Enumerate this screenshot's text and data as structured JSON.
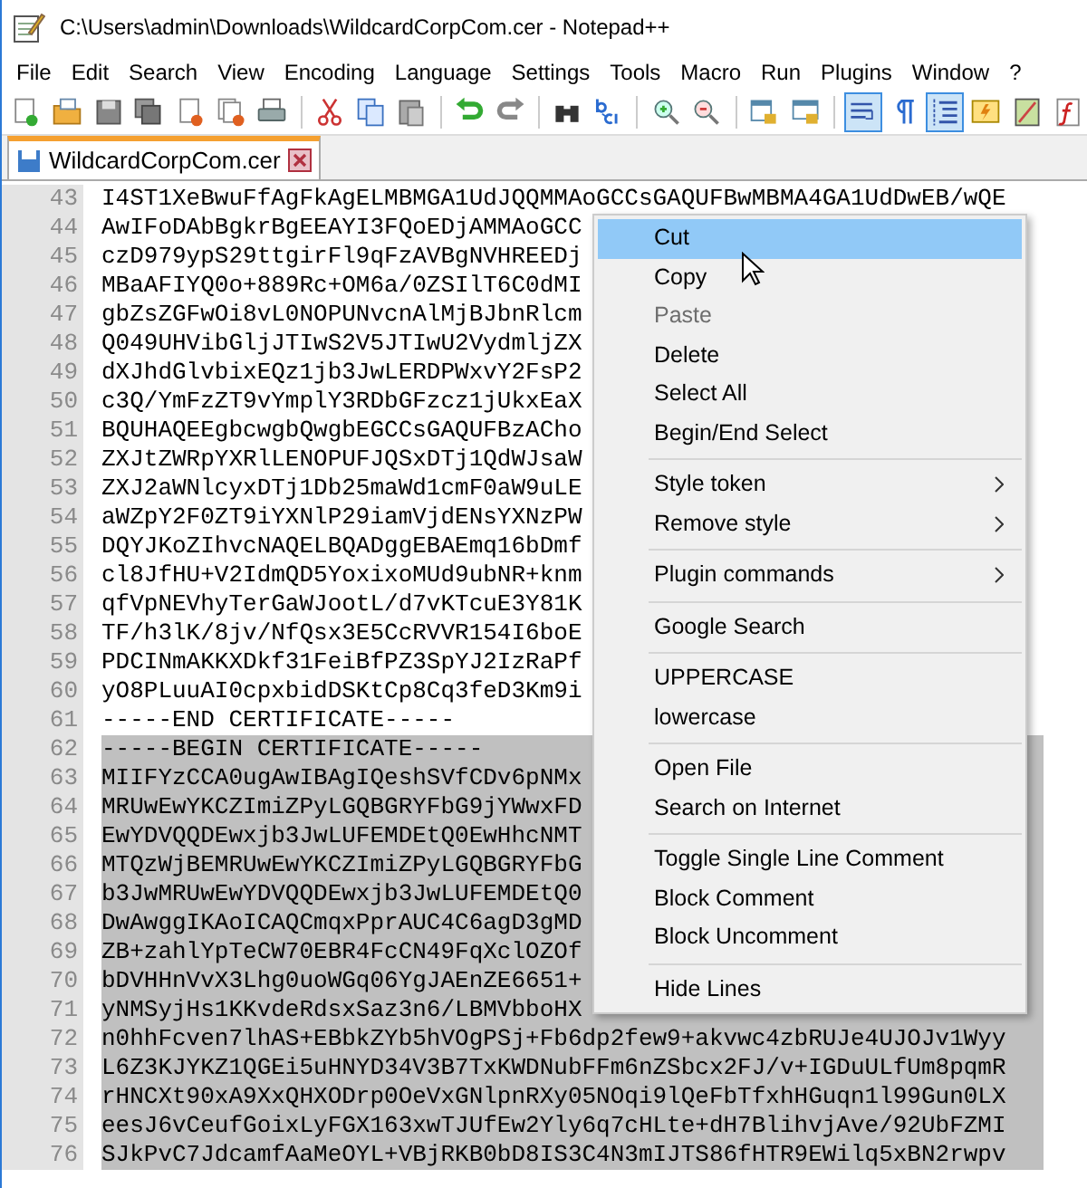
{
  "window": {
    "title": "C:\\Users\\admin\\Downloads\\WildcardCorpCom.cer - Notepad++"
  },
  "menu_bar": [
    "File",
    "Edit",
    "Search",
    "View",
    "Encoding",
    "Language",
    "Settings",
    "Tools",
    "Macro",
    "Run",
    "Plugins",
    "Window",
    "?"
  ],
  "toolbar": [
    {
      "kind": "new",
      "selected": false
    },
    {
      "kind": "open",
      "selected": false
    },
    {
      "kind": "save",
      "selected": false
    },
    {
      "kind": "save-all",
      "selected": false
    },
    {
      "kind": "close",
      "selected": false
    },
    {
      "kind": "close-all",
      "selected": false
    },
    {
      "kind": "print",
      "selected": false
    },
    {
      "kind": "separator"
    },
    {
      "kind": "cut",
      "selected": false
    },
    {
      "kind": "copy",
      "selected": false
    },
    {
      "kind": "paste",
      "selected": false
    },
    {
      "kind": "separator"
    },
    {
      "kind": "undo",
      "selected": false
    },
    {
      "kind": "redo",
      "selected": false
    },
    {
      "kind": "separator"
    },
    {
      "kind": "find",
      "selected": false
    },
    {
      "kind": "replace",
      "selected": false
    },
    {
      "kind": "separator"
    },
    {
      "kind": "zoom-in",
      "selected": false
    },
    {
      "kind": "zoom-out",
      "selected": false
    },
    {
      "kind": "separator"
    },
    {
      "kind": "sync-v",
      "selected": false
    },
    {
      "kind": "sync-h",
      "selected": false
    },
    {
      "kind": "separator"
    },
    {
      "kind": "wrap",
      "selected": true
    },
    {
      "kind": "all-chars",
      "selected": false
    },
    {
      "kind": "indent-guide",
      "selected": true
    },
    {
      "kind": "udl",
      "selected": false
    },
    {
      "kind": "doc-map",
      "selected": false
    },
    {
      "kind": "function-list",
      "selected": false
    }
  ],
  "tabs": [
    {
      "label": "WildcardCorpCom.cer",
      "selected": true
    }
  ],
  "editor": {
    "lines": [
      {
        "number": "43",
        "text": "I4ST1XeBwuFfAgFkAgELMBMGA1UdJQQMMAoGCCsGAQUFBwMBMA4GA1UdDwEB/wQE",
        "selected": false
      },
      {
        "number": "44",
        "text": "AwIFoDAbBgkrBgEEAYI3FQoEDjAMMAoGCC",
        "selected": false
      },
      {
        "number": "45",
        "text": "czD979ypS29ttgirFl9qFzAVBgNVHREEDj",
        "selected": false
      },
      {
        "number": "46",
        "text": "MBaAFIYQ0o+889Rc+OM6a/0ZSIlT6C0dMI",
        "selected": false
      },
      {
        "number": "47",
        "text": "gbZsZGFwOi8vL0NOPUNvcnAlMjBJbnRlcm",
        "selected": false
      },
      {
        "number": "48",
        "text": "Q049UHVibGljJTIwS2V5JTIwU2VydmljZX",
        "selected": false
      },
      {
        "number": "49",
        "text": "dXJhdGlvbixEQz1jb3JwLERDPWxvY2FsP2",
        "selected": false
      },
      {
        "number": "50",
        "text": "c3Q/YmFzZT9vYmplY3RDbGFzcz1jUkxEaX",
        "selected": false
      },
      {
        "number": "51",
        "text": "BQUHAQEEgbcwgbQwgbEGCCsGAQUFBzACho",
        "selected": false
      },
      {
        "number": "52",
        "text": "ZXJtZWRpYXRlLENOPUFJQSxDTj1QdWJsaW",
        "selected": false
      },
      {
        "number": "53",
        "text": "ZXJ2aWNlcyxDTj1Db25maWd1cmF0aW9uLE",
        "selected": false
      },
      {
        "number": "54",
        "text": "aWZpY2F0ZT9iYXNlP29iamVjdENsYXNzPW",
        "selected": false
      },
      {
        "number": "55",
        "text": "DQYJKoZIhvcNAQELBQADggEBAEmq16bDmf",
        "selected": false
      },
      {
        "number": "56",
        "text": "cl8JfHU+V2IdmQD5YoxixoMUd9ubNR+knm",
        "selected": false
      },
      {
        "number": "57",
        "text": "qfVpNEVhyTerGaWJootL/d7vKTcuE3Y81K",
        "selected": false
      },
      {
        "number": "58",
        "text": "TF/h3lK/8jv/NfQsx3E5CcRVVR154I6boE",
        "selected": false
      },
      {
        "number": "59",
        "text": "PDCINmAKKXDkf31FeiBfPZ3SpYJ2IzRaPf",
        "selected": false
      },
      {
        "number": "60",
        "text": "yO8PLuuAI0cpxbidDSKtCp8Cq3feD3Km9i",
        "selected": false
      },
      {
        "number": "61",
        "text": "-----END CERTIFICATE-----",
        "selected": false
      },
      {
        "number": "62",
        "text": "-----BEGIN CERTIFICATE-----",
        "selected": true
      },
      {
        "number": "63",
        "text": "MIIFYzCCA0ugAwIBAgIQeshSVfCDv6pNMx",
        "selected": true
      },
      {
        "number": "64",
        "text": "MRUwEwYKCZImiZPyLGQBGRYFbG9jYWwxFD",
        "selected": true
      },
      {
        "number": "65",
        "text": "EwYDVQQDEwxjb3JwLUFEMDEtQ0EwHhcNMT",
        "selected": true
      },
      {
        "number": "66",
        "text": "MTQzWjBEMRUwEwYKCZImiZPyLGQBGRYFbG",
        "selected": true
      },
      {
        "number": "67",
        "text": "b3JwMRUwEwYDVQQDEwxjb3JwLUFEMDEtQ0",
        "selected": true
      },
      {
        "number": "68",
        "text": "DwAwggIKAoICAQCmqxPprAUC4C6agD3gMD",
        "selected": true
      },
      {
        "number": "69",
        "text": "ZB+zahlYpTeCW70EBR4FcCN49FqXclOZOf",
        "selected": true
      },
      {
        "number": "70",
        "text": "bDVHHnVvX3Lhg0uoWGq06YgJAEnZE6651+",
        "selected": true
      },
      {
        "number": "71",
        "text": "yNMSyjHs1KKvdeRdsxSaz3n6/LBMVbboHX",
        "selected": true
      },
      {
        "number": "72",
        "text": "n0hhFcven7lhAS+EBbkZYb5hVOgPSj+Fb6dp2few9+akvwc4zbRUJe4UJOJv1Wyy",
        "selected": true
      },
      {
        "number": "73",
        "text": "L6Z3KJYKZ1QGEi5uHNYD34V3B7TxKWDNubFFm6nZSbcx2FJ/v+IGDuULfUm8pqmR",
        "selected": true
      },
      {
        "number": "74",
        "text": "rHNCXt90xA9XxQHXODrp0OeVxGNlpnRXy05NOqi9lQeFbTfxhHGuqn1l99Gun0LX",
        "selected": true
      },
      {
        "number": "75",
        "text": "eesJ6vCeufGoixLyFGX163xwTJUfEw2Yly6q7cHLte+dH7BlihvjAve/92UbFZMI",
        "selected": true
      },
      {
        "number": "76",
        "text": "SJkPvC7JdcamfAaMeOYL+VBjRKB0bD8IS3C4N3mIJTS86fHTR9EWilq5xBN2rwpv",
        "selected": true
      }
    ]
  },
  "context_menu": {
    "items": [
      {
        "kind": "item",
        "label": "Cut",
        "selected": true,
        "disabled": false,
        "submenu": false
      },
      {
        "kind": "item",
        "label": "Copy",
        "selected": false,
        "disabled": false,
        "submenu": false
      },
      {
        "kind": "item",
        "label": "Paste",
        "selected": false,
        "disabled": true,
        "submenu": false
      },
      {
        "kind": "item",
        "label": "Delete",
        "selected": false,
        "disabled": false,
        "submenu": false
      },
      {
        "kind": "item",
        "label": "Select All",
        "selected": false,
        "disabled": false,
        "submenu": false
      },
      {
        "kind": "item",
        "label": "Begin/End Select",
        "selected": false,
        "disabled": false,
        "submenu": false
      },
      {
        "kind": "separator"
      },
      {
        "kind": "item",
        "label": "Style token",
        "selected": false,
        "disabled": false,
        "submenu": true
      },
      {
        "kind": "item",
        "label": "Remove style",
        "selected": false,
        "disabled": false,
        "submenu": true
      },
      {
        "kind": "separator"
      },
      {
        "kind": "item",
        "label": "Plugin commands",
        "selected": false,
        "disabled": false,
        "submenu": true
      },
      {
        "kind": "separator"
      },
      {
        "kind": "item",
        "label": "Google Search",
        "selected": false,
        "disabled": false,
        "submenu": false
      },
      {
        "kind": "separator"
      },
      {
        "kind": "item",
        "label": "UPPERCASE",
        "selected": false,
        "disabled": false,
        "submenu": false
      },
      {
        "kind": "item",
        "label": "lowercase",
        "selected": false,
        "disabled": false,
        "submenu": false
      },
      {
        "kind": "separator"
      },
      {
        "kind": "item",
        "label": "Open File",
        "selected": false,
        "disabled": false,
        "submenu": false
      },
      {
        "kind": "item",
        "label": "Search on Internet",
        "selected": false,
        "disabled": false,
        "submenu": false
      },
      {
        "kind": "separator"
      },
      {
        "kind": "item",
        "label": "Toggle Single Line Comment",
        "selected": false,
        "disabled": false,
        "submenu": false
      },
      {
        "kind": "item",
        "label": "Block Comment",
        "selected": false,
        "disabled": false,
        "submenu": false
      },
      {
        "kind": "item",
        "label": "Block Uncomment",
        "selected": false,
        "disabled": false,
        "submenu": false
      },
      {
        "kind": "separator"
      },
      {
        "kind": "item",
        "label": "Hide Lines",
        "selected": false,
        "disabled": false,
        "submenu": false
      }
    ]
  }
}
